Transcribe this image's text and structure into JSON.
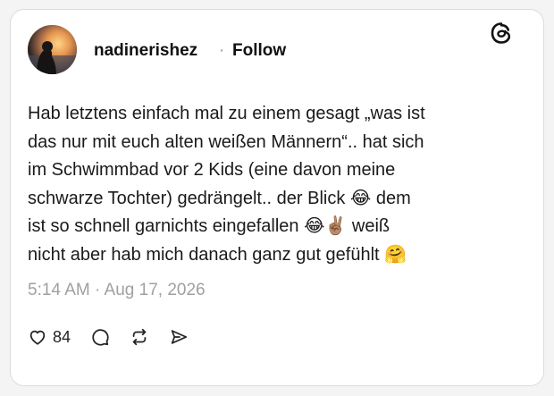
{
  "post": {
    "username": "nadinerishez",
    "separator": "·",
    "follow_label": "Follow",
    "text": "Hab letztens einfach mal zu einem gesagt „was ist\ndas nur mit euch alten weißen Männern“.. hat sich\nim Schwimmbad vor 2 Kids (eine davon meine\nschwarze Tochter) gedrängelt.. der Blick 😂 dem\nist so schnell garnichts eingefallen 😂✌🏽 weiß\nnicht aber hab mich danach ganz gut gefühlt 🤗",
    "timestamp": "5:14 AM · Aug 17, 2026"
  },
  "actions": {
    "like_count": "84",
    "icons": [
      "heart-icon",
      "comment-icon",
      "repost-icon",
      "share-icon"
    ]
  },
  "brand": {
    "logo": "threads-logo-icon"
  }
}
